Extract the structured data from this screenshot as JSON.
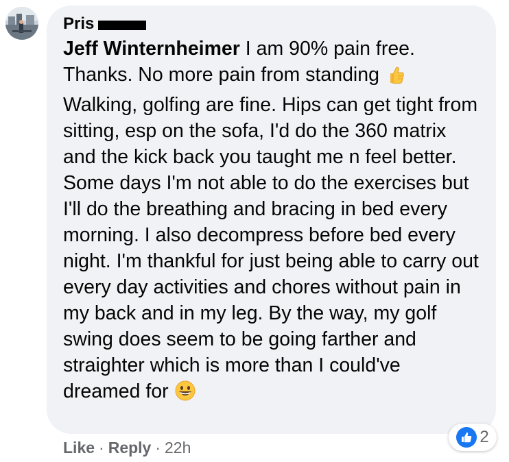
{
  "comment": {
    "author": "Pris",
    "mention": "Jeff Winternheimer",
    "text_parts": [
      " I am 90% pain free. Thanks. No more pain from standing ",
      " Walking, golfing are fine. Hips can get tight from sitting, esp on the sofa, I'd do the 360 matrix and the kick back you taught me n feel better. Some days I'm not able to do the exercises but I'll do the breathing and bracing in bed every morning. I also decompress before bed every night. I'm thankful for just being able to carry out every day activities and chores without pain in my back and in my leg. By the way, my golf swing does seem to be going farther and straighter which is more than I could've dreamed for "
    ],
    "emojis": [
      "thumbs-up",
      "grinning-face"
    ]
  },
  "reactions": {
    "count": "2",
    "type": "like",
    "color": "#1877f2"
  },
  "actions": {
    "like_label": "Like",
    "reply_label": "Reply",
    "separator": "·",
    "timestamp": "22h"
  }
}
